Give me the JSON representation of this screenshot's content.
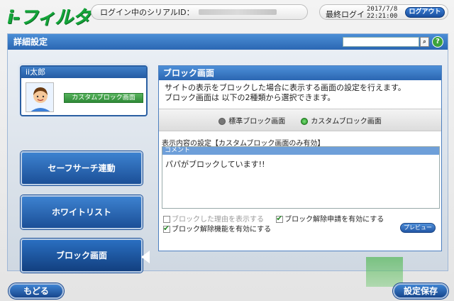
{
  "header": {
    "logo": "i-フィルター",
    "serial_label": "ログイン中のシリアルID：",
    "last_login_label": "最終ログイ",
    "last_login_date": "2017/7/8",
    "last_login_time": "22:21:00",
    "logout_label": "ログアウト"
  },
  "panel": {
    "title": "詳細設定",
    "search_placeholder": "",
    "search_icon": "search-icon",
    "help_icon": "?"
  },
  "user": {
    "name": "ii太郎",
    "mode_badge": "カスタムブロック画面"
  },
  "nav": {
    "safe_search": "セーフサーチ連動",
    "whitelist": "ホワイトリスト",
    "block_screen": "ブロック画面"
  },
  "content": {
    "title": "ブロック画面",
    "desc_line1": "サイトの表示をブロックした場合に表示する画面の設定を行えます。",
    "desc_line2": "ブロック画面は 以下の2種類から選択できます。",
    "radio_standard": "標準ブロック画面",
    "radio_custom": "カスタムブロック画面",
    "selected": "カスタムブロック画面",
    "settings_label": "表示内容の設定【カスタムブロック画面のみ有効】",
    "comment_header": "コメント",
    "comment_text": "パパがブロックしています!!",
    "opt_show_reason": "ブロックした理由を表示する",
    "opt_show_reason_checked": false,
    "opt_unblock_request": "ブロック解除申請を有効にする",
    "opt_unblock_request_checked": true,
    "opt_unblock_function": "ブロック解除機能を有効にする",
    "opt_unblock_function_checked": true,
    "preview_label": "プレビュー"
  },
  "footer": {
    "back_label": "もどる",
    "save_label": "設定保存"
  }
}
